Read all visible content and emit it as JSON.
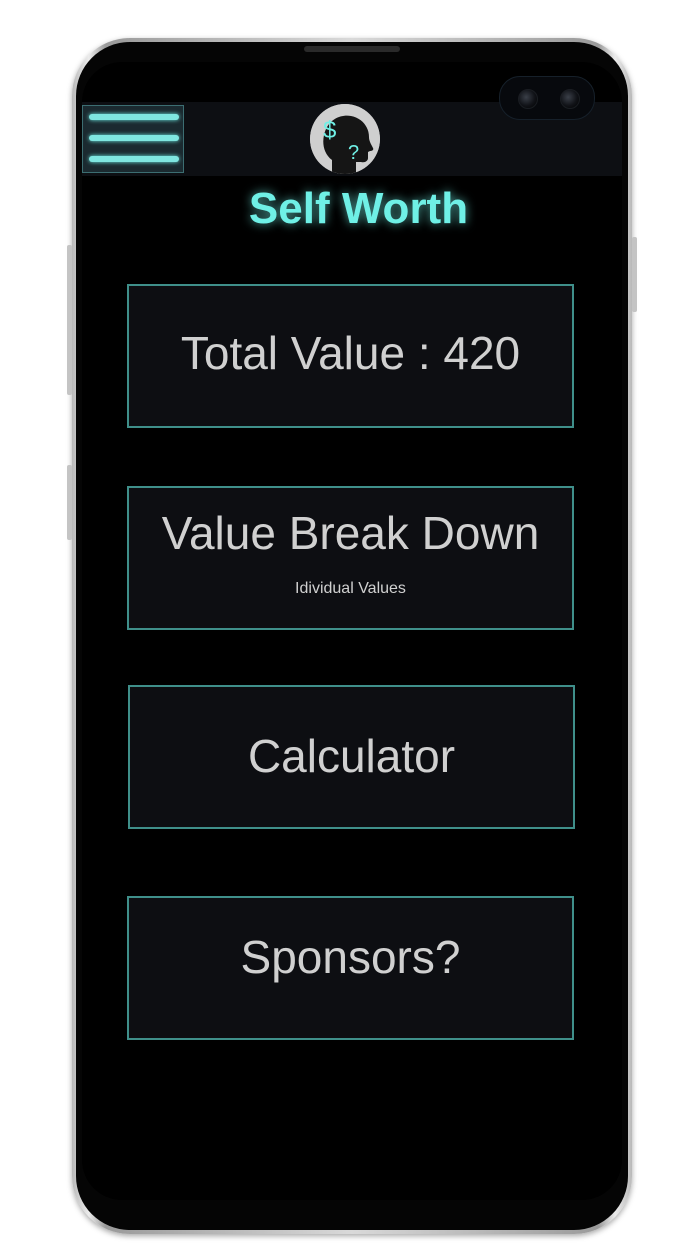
{
  "app": {
    "title": "Self Worth"
  },
  "header": {
    "menu_icon": "hamburger-menu-icon",
    "avatar_icon": "head-dollar-question-icon",
    "avatar_glyphs": {
      "dollar": "$",
      "question": "?"
    }
  },
  "cards": {
    "total_value": {
      "label": "Total Value : 420"
    },
    "value_breakdown": {
      "label": "Value Break Down",
      "sublabel": "Idividual Values"
    },
    "calculator": {
      "label": "Calculator"
    },
    "sponsors": {
      "label": "Sponsors?"
    }
  },
  "colors": {
    "accent": "#6ff0e6",
    "card_border": "#3f8f8a",
    "card_bg": "#0d0e12",
    "text": "#d0d0d0",
    "screen_bg": "#000000"
  }
}
